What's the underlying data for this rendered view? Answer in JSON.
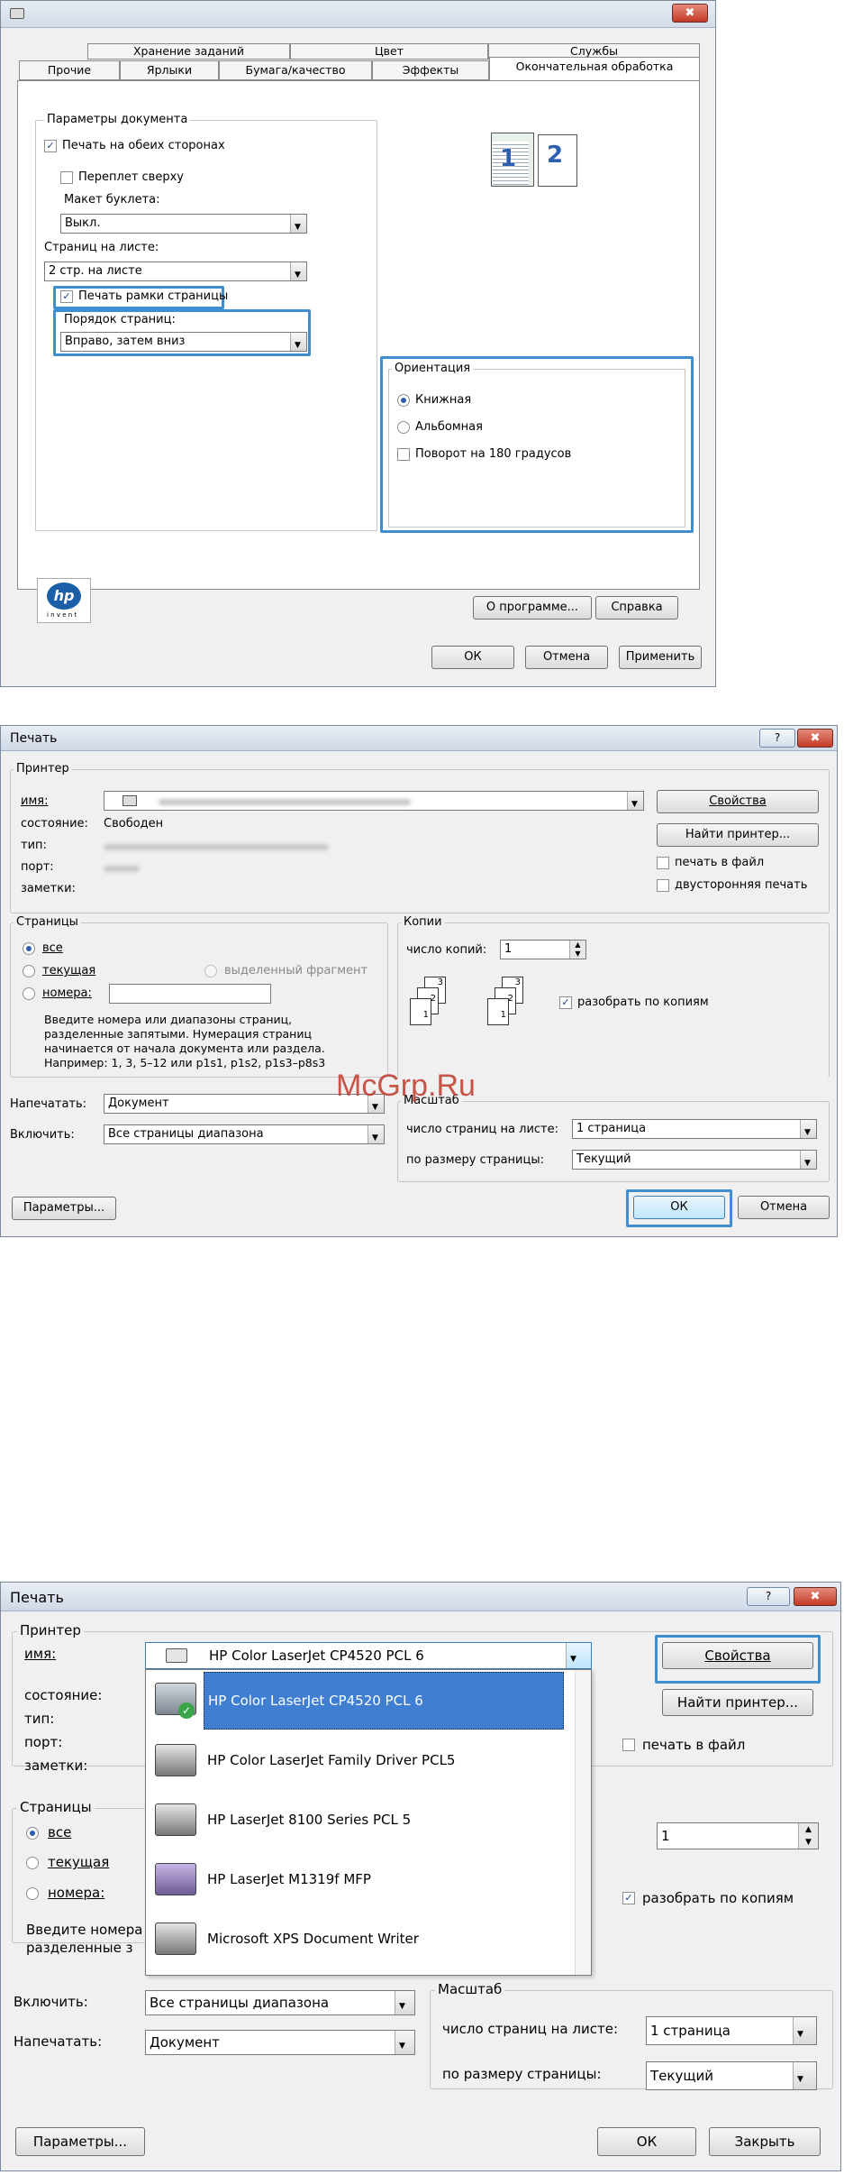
{
  "w1": {
    "close": "✖",
    "tabs_row1": [
      "Хранение заданий",
      "Цвет",
      "Службы"
    ],
    "tabs_row2": [
      "Прочие",
      "Ярлыки",
      "Бумага/качество",
      "Эффекты",
      "Окончательная обработка"
    ],
    "doc_params": "Параметры документа",
    "duplex": "Печать на обеих сторонах",
    "flip": "Переплет сверху",
    "booklet": "Макет буклета:",
    "booklet_val": "Выкл.",
    "pages_per_sheet": "Страниц на листе:",
    "pps_val": "2 стр. на листе",
    "borders": "Печать рамки страницы",
    "order": "Порядок страниц:",
    "order_val": "Вправо, затем вниз",
    "orient": "Ориентация",
    "portrait": "Книжная",
    "landscape": "Альбомная",
    "rotate": "Поворот на 180 градусов",
    "about": "О программе...",
    "help": "Справка",
    "ok": "ОК",
    "cancel": "Отмена",
    "apply": "Применить",
    "logo": "hp",
    "logo_sub": "i n v e n t",
    "preview_nums": [
      "1",
      "2"
    ]
  },
  "w2": {
    "title": "Печать",
    "q": "?",
    "close": "✖",
    "printer": "Принтер",
    "name": "имя:",
    "status": "состояние:",
    "status_val": "Свободен",
    "type": "тип:",
    "port": "порт:",
    "notes": "заметки:",
    "props": "Свойства",
    "find": "Найти принтер...",
    "tofile": "печать в файл",
    "duplex": "двусторонняя печать",
    "pages": "Страницы",
    "all": "все",
    "current": "текущая",
    "selection": "выделенный фрагмент",
    "numbers": "номера:",
    "hint": [
      "Введите номера или диапазоны страниц,",
      "разделенные запятыми. Нумерация страниц",
      "начинается от начала документа или раздела.",
      "Например: 1, 3, 5–12 или p1s1, p1s2, p1s3–p8s3"
    ],
    "copies": "Копии",
    "ncopies": "число копий:",
    "ncopies_val": "1",
    "collate": "разобрать по копиям",
    "print_what": "Напечатать:",
    "print_what_val": "Документ",
    "include": "Включить:",
    "include_val": "Все страницы диапазона",
    "zoom": "Масштаб",
    "pps": "число страниц на листе:",
    "pps_val": "1 страница",
    "fit": "по размеру страницы:",
    "fit_val": "Текущий",
    "options": "Параметры...",
    "ok": "ОК",
    "cancel": "Отмена",
    "watermark": "McGrp.Ru",
    "copy_pages": [
      "3",
      "2",
      "1"
    ]
  },
  "w3": {
    "title": "Печать",
    "q": "?",
    "close": "✖",
    "printer": "Принтер",
    "name": "имя:",
    "name_val": "HP Color LaserJet CP4520 PCL 6",
    "status": "состояние:",
    "type": "тип:",
    "port": "порт:",
    "notes": "заметки:",
    "props": "Свойства",
    "find": "Найти принтер...",
    "tofile": "печать в файл",
    "printers": [
      "HP Color LaserJet CP4520 PCL 6",
      "HP Color LaserJet Family Driver PCL5",
      "HP LaserJet 8100 Series PCL 5",
      "HP LaserJet M1319f MFP",
      "Microsoft XPS Document Writer"
    ],
    "pages": "Страницы",
    "all": "все",
    "current": "текущая",
    "numbers": "номера:",
    "hint": [
      "Введите номера",
      "разделенные з"
    ],
    "ncopies_val": "1",
    "collate": "разобрать по копиям",
    "include": "Включить:",
    "include_val": "Все страницы диапазона",
    "print_what": "Напечатать:",
    "print_what_val": "Документ",
    "zoom": "Масштаб",
    "pps": "число страниц на листе:",
    "pps_val": "1 страница",
    "fit": "по размеру страницы:",
    "fit_val": "Текущий",
    "options": "Параметры...",
    "ok": "ОК",
    "close_btn": "Закрыть"
  },
  "colors": {
    "highlight": "#3d8fd1",
    "selection": "#3f7ed0"
  }
}
